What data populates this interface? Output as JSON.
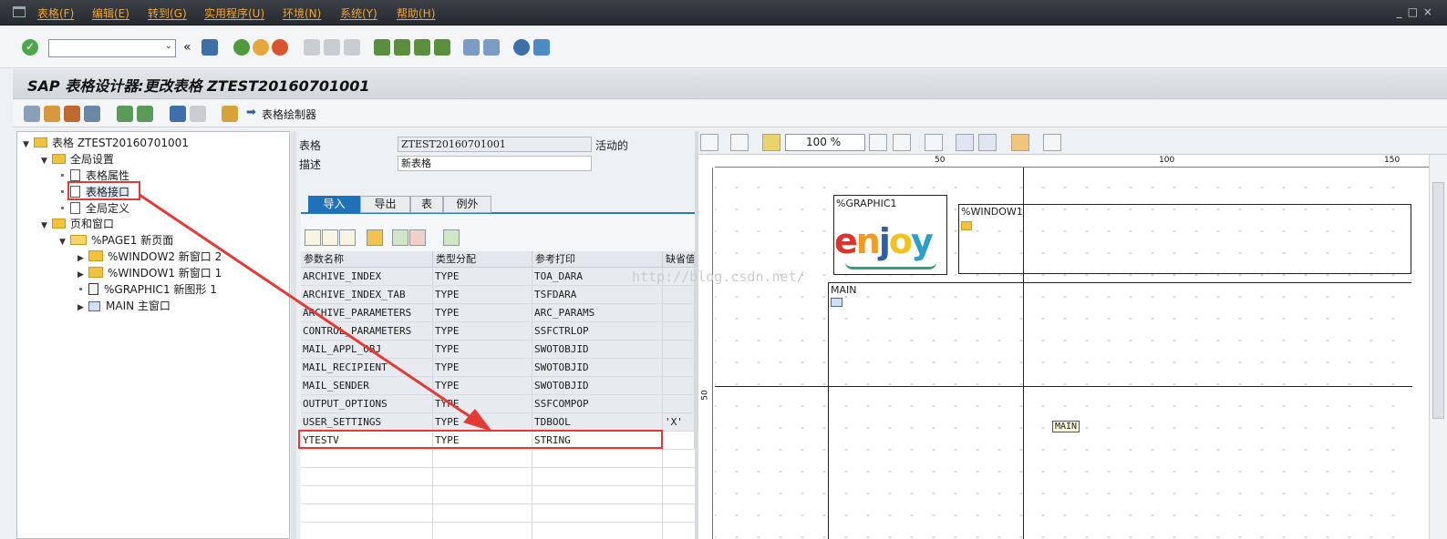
{
  "menu": {
    "items": [
      "表格(F)",
      "编辑(E)",
      "转到(G)",
      "实用程序(U)",
      "环境(N)",
      "系统(Y)",
      "帮助(H)"
    ]
  },
  "window_controls": "_□×",
  "command_field": {
    "value": "",
    "dropdown": "⌄"
  },
  "title": "SAP 表格设计器:更改表格 ZTEST20160701001",
  "app_toolbar": {
    "form_painter_label": "表格绘制器"
  },
  "tree": {
    "root": "表格 ZTEST20160701001",
    "global_settings": "全局设置",
    "form_attributes": "表格属性",
    "form_interface": "表格接口",
    "global_definitions": "全局定义",
    "pages_windows": "页和窗口",
    "page1": "%PAGE1 新页面",
    "window2": "%WINDOW2 新窗口 2",
    "window1": "%WINDOW1 新窗口 1",
    "graphic1": "%GRAPHIC1 新图形 1",
    "main": "MAIN 主窗口"
  },
  "detail": {
    "form_label": "表格",
    "form_value": "ZTEST20160701001",
    "status": "活动的",
    "desc_label": "描述",
    "desc_value": "新表格",
    "tabs": [
      "导入",
      "导出",
      "表",
      "例外"
    ]
  },
  "grid": {
    "headers": [
      "参数名称",
      "类型分配",
      "参考打印",
      "缺省值"
    ],
    "rows": [
      [
        "ARCHIVE_INDEX",
        "TYPE",
        "TOA_DARA",
        ""
      ],
      [
        "ARCHIVE_INDEX_TAB",
        "TYPE",
        "TSFDARA",
        ""
      ],
      [
        "ARCHIVE_PARAMETERS",
        "TYPE",
        "ARC_PARAMS",
        ""
      ],
      [
        "CONTROL_PARAMETERS",
        "TYPE",
        "SSFCTRLOP",
        ""
      ],
      [
        "MAIL_APPL_OBJ",
        "TYPE",
        "SWOTOBJID",
        ""
      ],
      [
        "MAIL_RECIPIENT",
        "TYPE",
        "SWOTOBJID",
        ""
      ],
      [
        "MAIL_SENDER",
        "TYPE",
        "SWOTOBJID",
        ""
      ],
      [
        "OUTPUT_OPTIONS",
        "TYPE",
        "SSFCOMPOP",
        ""
      ],
      [
        "USER_SETTINGS",
        "TYPE",
        "TDBOOL",
        "'X'"
      ],
      [
        "YTESTV",
        "TYPE",
        "STRING",
        ""
      ]
    ]
  },
  "painter": {
    "zoom": "100 %",
    "ruler_top": [
      "50",
      "100",
      "150"
    ],
    "ruler_left": [
      "50"
    ],
    "graphic_title": "%GRAPHIC1",
    "logo_text": "enjoy",
    "window1_title": "%WINDOW1",
    "main_title": "MAIN",
    "main_tag": "MAIN"
  },
  "watermark": "http://blog.csdn.net/",
  "colors": {
    "accent": "#1f71b8",
    "highlight": "#e53935",
    "menu_text": "#f0a630"
  }
}
